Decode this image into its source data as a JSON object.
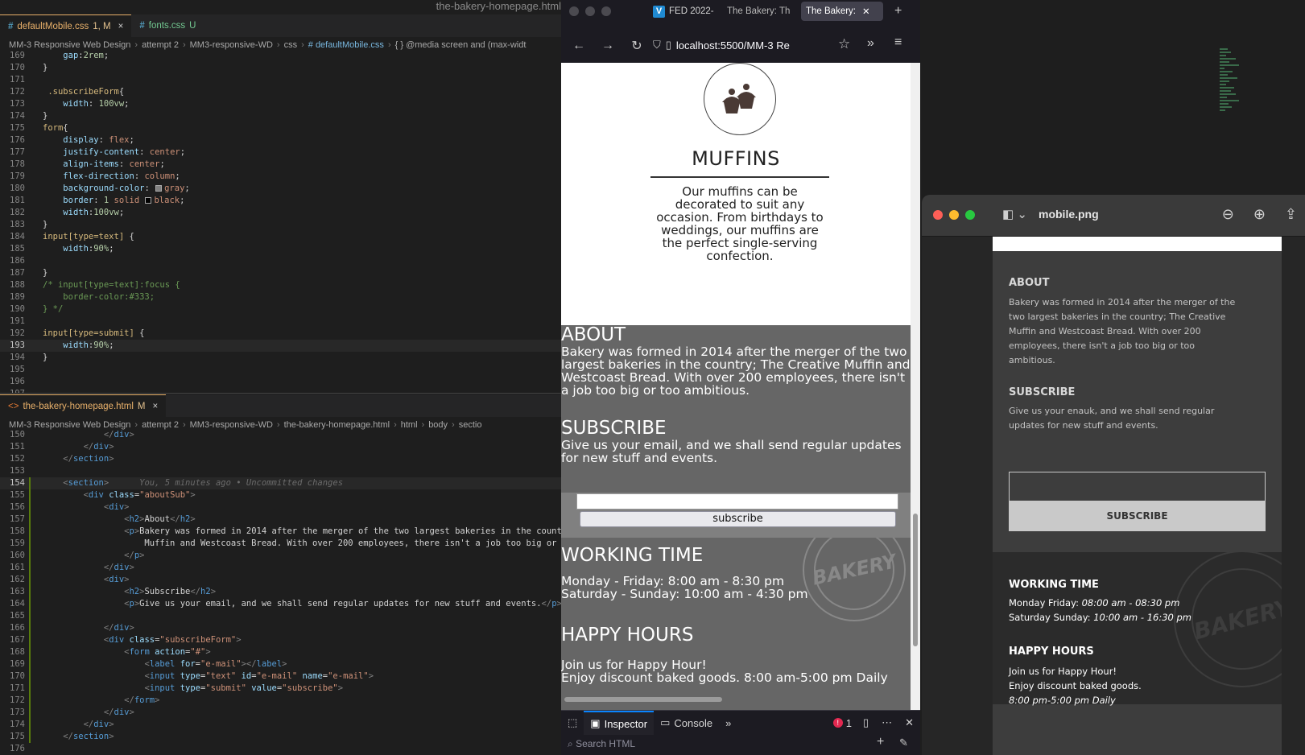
{
  "window_title": "the-bakery-homepage.html",
  "css_editor": {
    "tabs": [
      {
        "name": "defaultMobile.css",
        "status": "1, M",
        "active": true
      },
      {
        "name": "fonts.css",
        "status": "U",
        "active": false
      }
    ],
    "breadcrumb": [
      "MM-3 Responsive Web Design",
      "attempt 2",
      "MM3-responsive-WD",
      "css",
      "# defaultMobile.css",
      "{ } @media screen and (max-widt"
    ],
    "line_numbers": [
      "169",
      "170",
      "171",
      "172",
      "173",
      "174",
      "175",
      "176",
      "177",
      "178",
      "179",
      "180",
      "181",
      "182",
      "183",
      "184",
      "185",
      "186",
      "187",
      "188",
      "189",
      "190",
      "191",
      "192",
      "193",
      "194",
      "195",
      "196",
      "197"
    ],
    "current_line": "193"
  },
  "html_editor": {
    "tab": {
      "name": "the-bakery-homepage.html",
      "status": "M"
    },
    "breadcrumb": [
      "MM-3 Responsive Web Design",
      "attempt 2",
      "MM3-responsive-WD",
      "the-bakery-homepage.html",
      "html",
      "body",
      "sectio"
    ],
    "line_numbers": [
      "150",
      "151",
      "152",
      "153",
      "154",
      "155",
      "156",
      "157",
      "158",
      "159",
      "160",
      "161",
      "162",
      "163",
      "164",
      "165",
      "166",
      "167",
      "168",
      "169",
      "170",
      "171",
      "172",
      "173",
      "174",
      "175",
      "176"
    ],
    "blame": "You, 5 minutes ago • Uncommitted changes"
  },
  "browser": {
    "tabs": [
      "FED 2022-",
      "The Bakery: Th",
      "The Bakery:"
    ],
    "url": "localhost:5500/MM-3 Re",
    "muffins": {
      "title": "MUFFINS",
      "text": "Our muffins can be decorated to suit any occasion. From birthdays to weddings, our muffins are the perfect single-serving confection."
    },
    "about": {
      "title": "ABOUT",
      "text": "Bakery was formed in 2014 after the merger of the two largest bakeries in the country; The Creative Muffin and Westcoast Bread. With over 200 employees, there isn't a job too big or too ambitious."
    },
    "subscribe": {
      "title": "SUBSCRIBE",
      "text": "Give us your email, and we shall send regular updates for new stuff and events.",
      "button": "subscribe"
    },
    "working_time": {
      "title": "WORKING TIME",
      "line1": "Monday - Friday: 8:00 am - 8:30 pm",
      "line2": "Saturday - Sunday: 10:00 am - 4:30 pm"
    },
    "happy_hours": {
      "title": "HAPPY HOURS",
      "line1": "Join us for Happy Hour!",
      "line2": "Enjoy discount baked goods. 8:00 am-5:00 pm Daily"
    },
    "stamp": "BAKERY",
    "devtools": {
      "inspector": "Inspector",
      "console": "Console",
      "errors": "1",
      "search_placeholder": "Search HTML"
    }
  },
  "preview": {
    "filename": "mobile.png",
    "about": {
      "title": "ABOUT",
      "text": "Bakery was formed in 2014 after the merger of the two largest bakeries in the country; The Creative Muffin and Westcoast Bread. With over 200 employees, there isn't a job too big or too ambitious."
    },
    "subscribe": {
      "title": "SUBSCRIBE",
      "text": "Give us your enauk, and we shall send regular updates for new stuff and events.",
      "button": "SUBSCRIBE"
    },
    "working_time": {
      "title": "WORKING TIME",
      "label1": "Monday Friday:",
      "time1": "08:00 am - 08:30 pm",
      "label2": "Saturday Sunday:",
      "time2": "10:00 am - 16:30 pm"
    },
    "happy_hours": {
      "title": "HAPPY HOURS",
      "line1": "Join us for Happy Hour!",
      "line2": "Enjoy discount baked goods.",
      "line3": "8:00 pm-5:00 pm Daily"
    },
    "stamp": "BAKERY"
  },
  "colors": {
    "css_selector": "#d7ba7d",
    "css_property": "#9cdcfe",
    "css_value": "#ce9178",
    "html_tag": "#569cd6",
    "active_tab": "#e8b06a",
    "browser_grey_section": "#666666"
  }
}
